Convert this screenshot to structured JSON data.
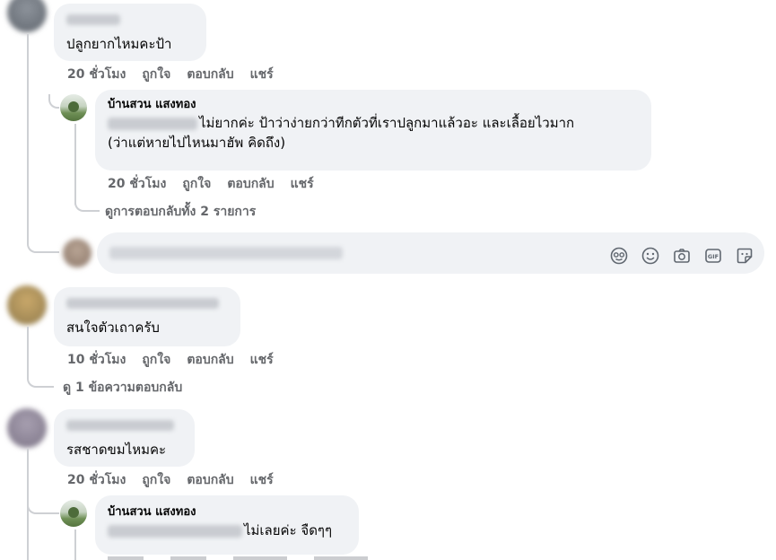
{
  "comment1": {
    "text": "ปลูกยากไหมคะป้า",
    "actions": [
      "20 ชั่วโมง",
      "ถูกใจ",
      "ตอบกลับ",
      "แชร์"
    ]
  },
  "reply1": {
    "author": "บ้านสวน แสงทอง",
    "text_line1": "ไม่ยากค่ะ ป้าว่าง่ายกว่าทีกตัวที่เราปลูกมาแล้วอะ และเลื้อยไวมาก",
    "text_line2": "(ว่าแต่หายไปไหนมาฮัพ คิดถึง)",
    "actions": [
      "20 ชั่วโมง",
      "ถูกใจ",
      "ตอบกลับ",
      "แชร์"
    ]
  },
  "view_all_replies": "ดูการตอบกลับทั้ง 2 รายการ",
  "reply_composer": {
    "icons": [
      "sticker-face-icon",
      "emoji-icon",
      "camera-icon",
      "gif-icon",
      "sticker-icon"
    ],
    "gif_label": "GIF"
  },
  "comment2": {
    "text": "สนใจตัวเถาครับ",
    "actions": [
      "10 ชั่วโมง",
      "ถูกใจ",
      "ตอบกลับ",
      "แชร์"
    ]
  },
  "view_one_reply": "ดู 1 ข้อความตอบกลับ",
  "comment3": {
    "text": "รสชาดขมไหมคะ",
    "actions": [
      "20 ชั่วโมง",
      "ถูกใจ",
      "ตอบกลับ",
      "แชร์"
    ]
  },
  "reply2": {
    "author": "บ้านสวน แสงทอง",
    "text": "ไม่เลยค่ะ จืดๆๆ"
  },
  "colors": {
    "bubble": "#f0f2f5",
    "meta_text": "#65676b",
    "thread_line": "#ced0d4"
  }
}
